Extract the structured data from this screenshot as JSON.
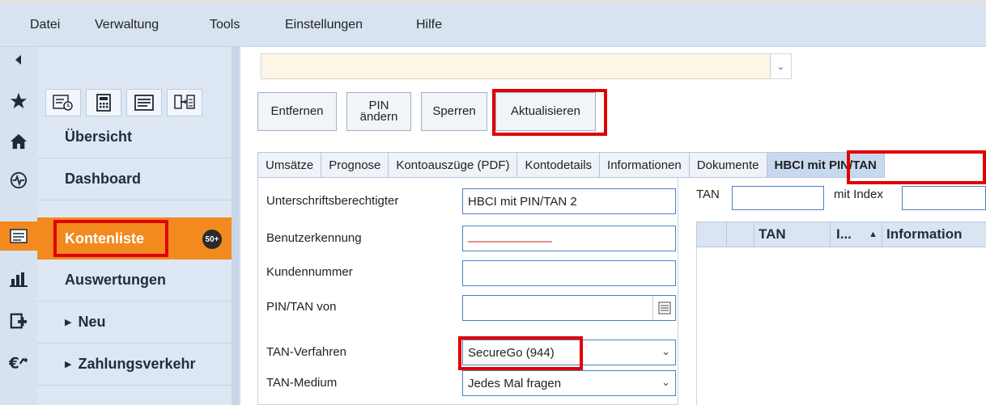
{
  "menu": [
    "Datei",
    "Verwaltung",
    "Tools",
    "Einstellungen",
    "Hilfe"
  ],
  "sidebar": {
    "items": [
      {
        "label": "Übersicht"
      },
      {
        "label": "Dashboard"
      },
      {
        "label": "Kontenliste",
        "badge": "50+"
      },
      {
        "label": "Auswertungen"
      },
      {
        "label": "Neu"
      },
      {
        "label": "Zahlungsverkehr"
      }
    ]
  },
  "buttons": {
    "remove": "Entfernen",
    "pin_change_line1": "PIN",
    "pin_change_line2": "ändern",
    "lock": "Sperren",
    "refresh": "Aktualisieren"
  },
  "tabs": [
    "Umsätze",
    "Prognose",
    "Kontoauszüge (PDF)",
    "Kontodetails",
    "Informationen",
    "Dokumente",
    "HBCI mit PIN/TAN"
  ],
  "form": {
    "signatory_label": "Unterschriftsberechtigter",
    "signatory_value": "HBCI mit PIN/TAN 2",
    "user_id_label": "Benutzerkennung",
    "user_id_value": "",
    "customer_no_label": "Kundennummer",
    "customer_no_value": "",
    "pintan_from_label": "PIN/TAN von",
    "pintan_from_value": "",
    "tan_method_label": "TAN-Verfahren",
    "tan_method_value": "SecureGo (944)",
    "tan_medium_label": "TAN-Medium",
    "tan_medium_value": "Jedes Mal fragen"
  },
  "tan": {
    "tan_label": "TAN",
    "index_label": "mit Index",
    "col_tan": "TAN",
    "col_index": "I...",
    "col_info": "Information"
  },
  "colors": {
    "accent": "#f28a1f",
    "highlight": "#e00000",
    "menubar": "#d8e3f1"
  }
}
